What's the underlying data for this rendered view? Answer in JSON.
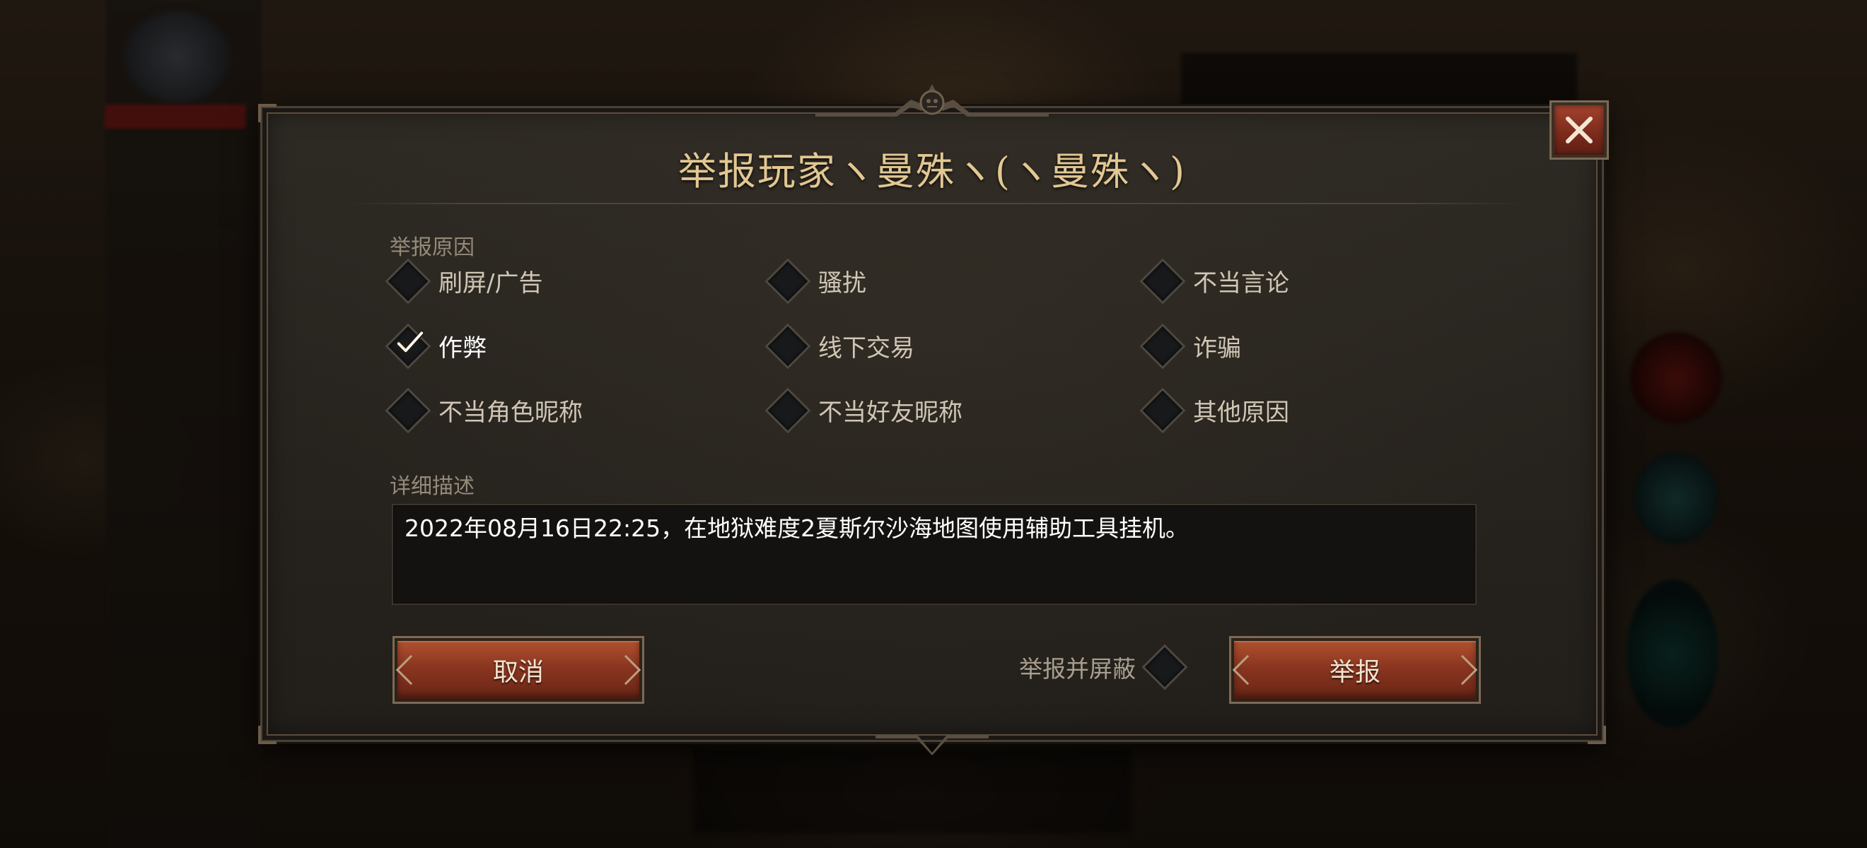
{
  "dialog": {
    "title": "举报玩家ヽ曼殊ヽ(ヽ曼殊ヽ)",
    "reason_section_label": "举报原因",
    "description_section_label": "详细描述",
    "description_value": "2022年08月16日22:25，在地狱难度2夏斯尔沙海地图使用辅助工具挂机。",
    "reasons": [
      {
        "label": "刷屏/广告",
        "checked": false
      },
      {
        "label": "骚扰",
        "checked": false
      },
      {
        "label": "不当言论",
        "checked": false
      },
      {
        "label": "作弊",
        "checked": true
      },
      {
        "label": "线下交易",
        "checked": false
      },
      {
        "label": "诈骗",
        "checked": false
      },
      {
        "label": "不当角色昵称",
        "checked": false
      },
      {
        "label": "不当好友昵称",
        "checked": false
      },
      {
        "label": "其他原因",
        "checked": false
      }
    ],
    "cancel_label": "取消",
    "report_label": "举报",
    "block_label": "举报并屏蔽",
    "block_checked": false,
    "close_icon": "close-icon"
  },
  "colors": {
    "title": "#e2c792",
    "accent_button": "#8a3520",
    "checkmark": "#ffffff"
  }
}
